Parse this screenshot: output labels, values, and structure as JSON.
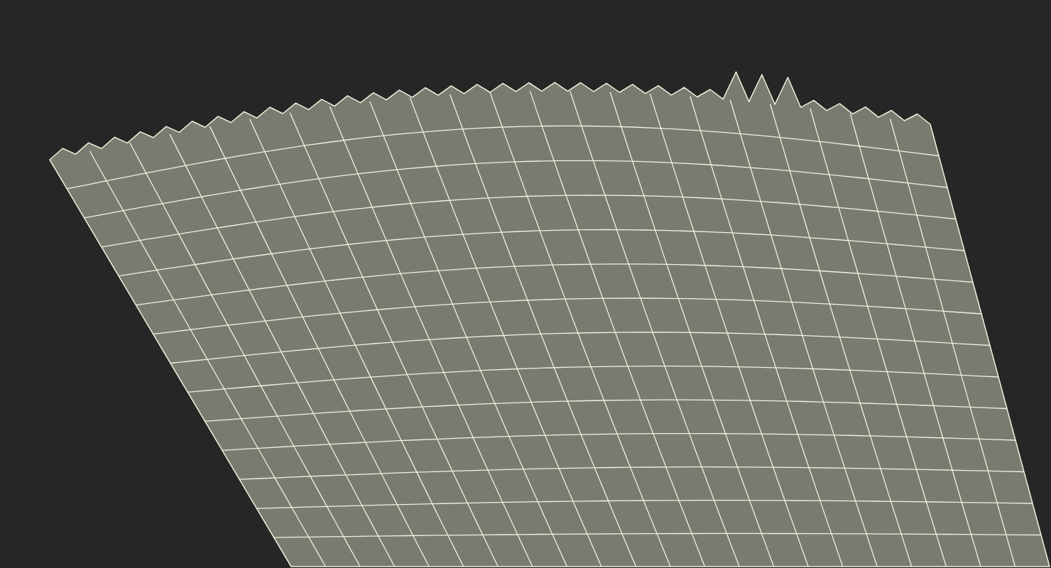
{
  "scene": {
    "kind": "wireframe-render"
  }
}
